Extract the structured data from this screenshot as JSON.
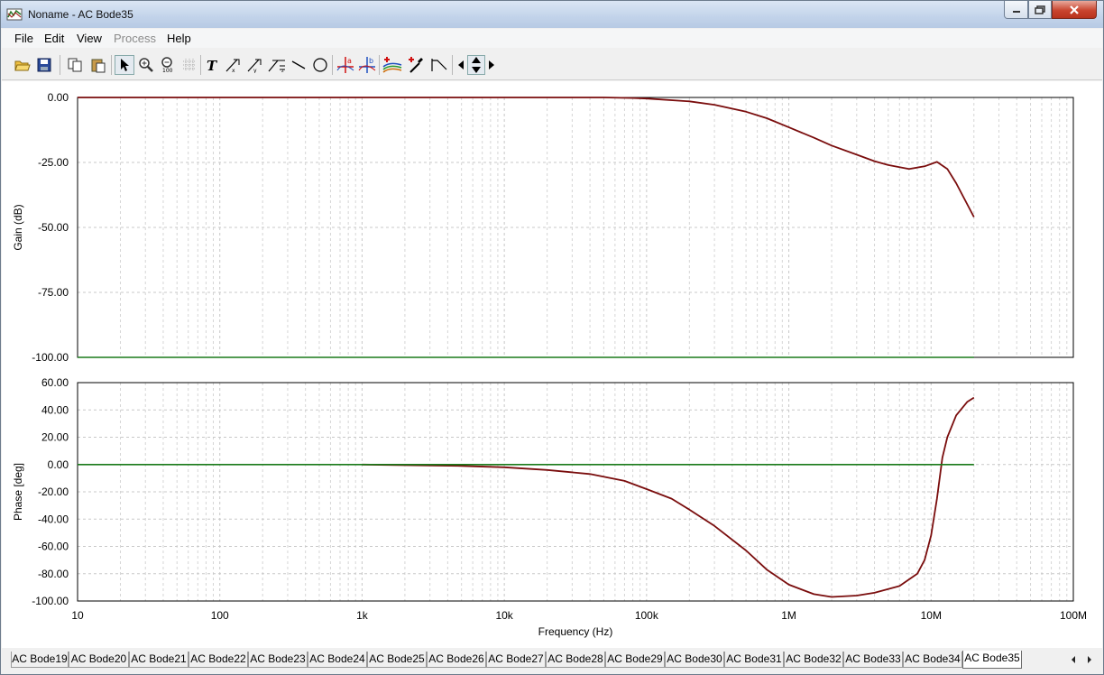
{
  "window": {
    "title": "Noname - AC Bode35",
    "menu": [
      "File",
      "Edit",
      "View",
      "Process",
      "Help"
    ],
    "menu_disabled": [
      "Process"
    ]
  },
  "toolbar": {
    "icons": [
      "open-folder-icon",
      "save-icon",
      "copy-icon",
      "paste-icon",
      "pointer-icon",
      "zoom-in-icon",
      "zoom-100-icon",
      "grid-icon",
      "text-icon",
      "axis-label-x-icon",
      "axis-label-y-icon",
      "axis-label-z-icon",
      "line-icon",
      "circle-icon",
      "cursor-a-icon",
      "cursor-b-icon",
      "add-curve-icon",
      "add-marker-icon",
      "fit-icon",
      "arrow-left-icon",
      "arrow-up-down-icon",
      "arrow-right-icon"
    ]
  },
  "tabs": {
    "items": [
      "AC Bode19",
      "AC Bode20",
      "AC Bode21",
      "AC Bode22",
      "AC Bode23",
      "AC Bode24",
      "AC Bode25",
      "AC Bode26",
      "AC Bode27",
      "AC Bode28",
      "AC Bode29",
      "AC Bode30",
      "AC Bode31",
      "AC Bode32",
      "AC Bode33",
      "AC Bode34",
      "AC Bode35"
    ],
    "active": "AC Bode35"
  },
  "colors": {
    "curve": "#7a0d0d",
    "reference": "#1a7a1a",
    "grid": "#c8c8c8"
  },
  "chart_data": [
    {
      "type": "line",
      "ylabel": "Gain (dB)",
      "xscale": "log",
      "xlim": [
        10,
        100000000
      ],
      "ylim": [
        -100,
        0
      ],
      "yticks": [
        0,
        -25,
        -50,
        -75,
        -100
      ],
      "ytick_labels": [
        "0.00",
        "-25.00",
        "-50.00",
        "-75.00",
        "-100.00"
      ],
      "grid": true,
      "series": [
        {
          "role": "curve",
          "x": [
            10,
            100,
            1000,
            10000,
            50000,
            80000,
            100000,
            200000,
            300000,
            500000,
            700000,
            1000000,
            1500000,
            2000000,
            3000000,
            4000000,
            5000000,
            7000000,
            9000000,
            11000000,
            13000000,
            15000000,
            20000000
          ],
          "y": [
            0,
            0,
            0,
            0,
            0,
            -0.2,
            -0.4,
            -1.5,
            -2.8,
            -5.5,
            -8.0,
            -11.5,
            -15.5,
            -18.5,
            -22.0,
            -24.5,
            -26.0,
            -27.5,
            -26.5,
            -24.8,
            -27.5,
            -33.0,
            -46.0
          ]
        },
        {
          "role": "reference",
          "x": [
            10,
            20000000
          ],
          "y": [
            -100,
            -100
          ]
        }
      ]
    },
    {
      "type": "line",
      "ylabel": "Phase [deg]",
      "xlabel": "Frequency (Hz)",
      "xscale": "log",
      "xlim": [
        10,
        100000000
      ],
      "ylim": [
        -100,
        60
      ],
      "yticks": [
        60,
        40,
        20,
        0,
        -20,
        -40,
        -60,
        -80,
        -100
      ],
      "ytick_labels": [
        "60.00",
        "40.00",
        "20.00",
        "0.00",
        "-20.00",
        "-40.00",
        "-60.00",
        "-80.00",
        "-100.00"
      ],
      "xticks": [
        10,
        100,
        1000,
        10000,
        100000,
        1000000,
        10000000,
        100000000
      ],
      "xtick_labels": [
        "10",
        "100",
        "1k",
        "10k",
        "100k",
        "1M",
        "10M",
        "100M"
      ],
      "grid": true,
      "series": [
        {
          "role": "curve",
          "x": [
            1000,
            5000,
            10000,
            20000,
            40000,
            70000,
            100000,
            150000,
            200000,
            300000,
            500000,
            700000,
            1000000,
            1500000,
            2000000,
            3000000,
            4000000,
            6000000,
            8000000,
            9000000,
            10000000,
            11000000,
            12000000,
            13000000,
            15000000,
            18000000,
            20000000
          ],
          "y": [
            0,
            -1,
            -2,
            -4,
            -7,
            -12,
            -18,
            -25,
            -33,
            -45,
            -63,
            -77,
            -88,
            -95,
            -97,
            -96,
            -94,
            -89,
            -80,
            -70,
            -52,
            -25,
            5,
            20,
            36,
            46,
            49
          ]
        },
        {
          "role": "reference",
          "x": [
            10,
            20000000
          ],
          "y": [
            0,
            0
          ]
        }
      ]
    }
  ]
}
